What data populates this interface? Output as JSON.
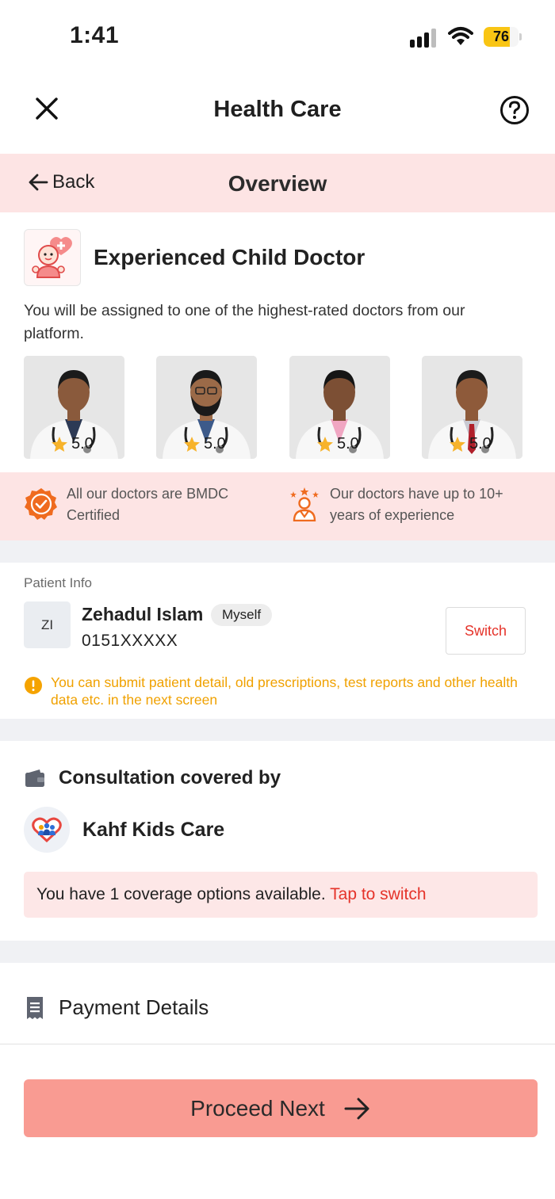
{
  "status_bar": {
    "time": "1:41",
    "battery_level": "76",
    "battery_fraction": 0.76
  },
  "nav": {
    "title": "Health Care"
  },
  "overview_bar": {
    "back_label": "Back",
    "title": "Overview"
  },
  "doctor_section": {
    "title": "Experienced Child Doctor",
    "description": "You will be assigned to one of the highest-rated doctors from our platform.",
    "doctors": [
      {
        "rating": "5.0"
      },
      {
        "rating": "5.0"
      },
      {
        "rating": "5.0"
      },
      {
        "rating": "5.0"
      }
    ],
    "features": [
      {
        "text": "All our doctors are BMDC Certified",
        "icon": "certified-badge-icon"
      },
      {
        "text": "Our doctors have up to 10+ years of experience",
        "icon": "doctor-stars-icon"
      }
    ]
  },
  "patient": {
    "section_label": "Patient Info",
    "initials": "ZI",
    "name": "Zehadul Islam",
    "relation": "Myself",
    "phone": "0151XXXXX",
    "switch_label": "Switch",
    "note": "You can submit patient detail, old prescriptions, test reports and other health data etc. in the next screen"
  },
  "coverage": {
    "title": "Consultation covered by",
    "plan_name": "Kahf Kids Care",
    "options_text": "You have 1 coverage options available.",
    "switch_link": "Tap to switch"
  },
  "payment": {
    "title": "Payment Details"
  },
  "footer": {
    "proceed_label": "Proceed Next"
  },
  "colors": {
    "accent": "#e5332a",
    "band_pink": "#fde4e4",
    "button": "#f99b92",
    "warning": "#f0a100",
    "star": "#f7b32b",
    "battery": "#f9c514"
  }
}
